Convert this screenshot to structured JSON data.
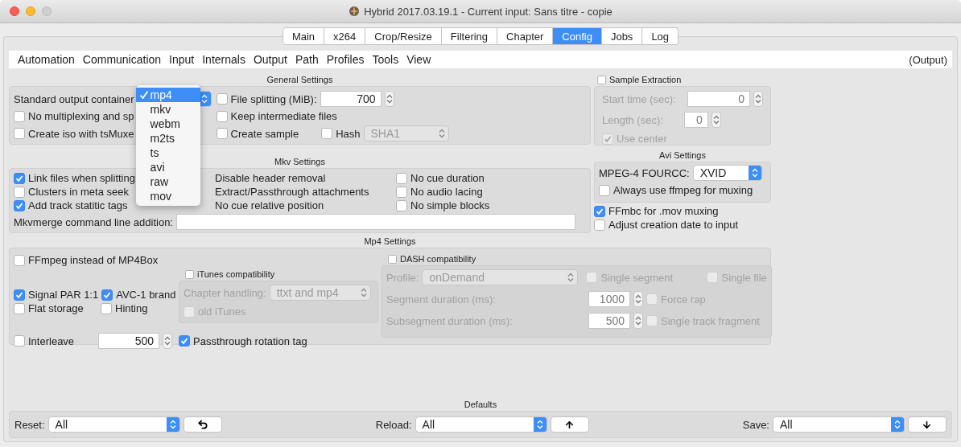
{
  "window": {
    "title": "Hybrid 2017.03.19.1 - Current input: Sans titre - copie"
  },
  "tabs": [
    {
      "label": "Main",
      "selected": false
    },
    {
      "label": "x264",
      "selected": false
    },
    {
      "label": "Crop/Resize",
      "selected": false
    },
    {
      "label": "Filtering",
      "selected": false
    },
    {
      "label": "Chapter",
      "selected": false
    },
    {
      "label": "Config",
      "selected": true
    },
    {
      "label": "Jobs",
      "selected": false
    },
    {
      "label": "Log",
      "selected": false
    }
  ],
  "menu": [
    "Automation",
    "Communication",
    "Input",
    "Internals",
    "Output",
    "Path",
    "Profiles",
    "Tools",
    "View"
  ],
  "menu_context": "(Output)",
  "general": {
    "title": "General Settings",
    "container_label": "Standard output container",
    "container_options": [
      {
        "label": "mp4",
        "selected": true
      },
      {
        "label": "mkv",
        "selected": false
      },
      {
        "label": "webm",
        "selected": false
      },
      {
        "label": "m2ts",
        "selected": false
      },
      {
        "label": "ts",
        "selected": false
      },
      {
        "label": "avi",
        "selected": false
      },
      {
        "label": "raw",
        "selected": false
      },
      {
        "label": "mov",
        "selected": false
      }
    ],
    "file_splitting": {
      "label": "File splitting (MiB):",
      "checked": false,
      "value": "700"
    },
    "no_multiplexing": {
      "label": "No multiplexing and sp",
      "checked": false
    },
    "keep_intermediate": {
      "label": "Keep intermediate files",
      "checked": false
    },
    "create_iso": {
      "label": "Create iso with tsMuxe",
      "checked": false
    },
    "create_sample": {
      "label": "Create sample",
      "checked": false
    },
    "hash": {
      "label": "Hash",
      "checked": false,
      "value": "SHA1",
      "disabled": true
    }
  },
  "sample_extraction": {
    "label": "Sample Extraction",
    "checked": false,
    "start_label": "Start time (sec):",
    "start_value": "0",
    "length_label": "Length (sec):",
    "length_value": "0",
    "use_center": {
      "label": "Use center",
      "checked": true
    }
  },
  "mkv": {
    "title": "Mkv Settings",
    "options_left": [
      {
        "label": "Link files when splitting",
        "checked": true
      },
      {
        "label": "Clusters in meta seek",
        "checked": false
      },
      {
        "label": "Add track statitic tags",
        "checked": true
      }
    ],
    "options_middle": [
      "Disable header removal",
      "Extract/Passthrough attachments",
      "No cue relative position"
    ],
    "options_right": [
      {
        "label": "No cue duration",
        "checked": false
      },
      {
        "label": "No audio lacing",
        "checked": false
      },
      {
        "label": "No simple blocks",
        "checked": false
      }
    ],
    "command_label": "Mkvmerge command line addition:"
  },
  "avi": {
    "title": "Avi Settings",
    "fourcc_label": "MPEG-4 FOURCC:",
    "fourcc_value": "XVID",
    "always_ffmpeg": {
      "label": "Always use ffmpeg for muxing",
      "checked": false
    }
  },
  "extra_options": [
    {
      "label": "FFmbc for .mov muxing",
      "checked": true
    },
    {
      "label": "Adjust creation date to input",
      "checked": false
    }
  ],
  "mp4": {
    "title": "Mp4 Settings",
    "ffmpeg": {
      "label": "FFmpeg instead of MP4Box",
      "checked": false
    },
    "signal_par": {
      "label": "Signal PAR 1:1",
      "checked": true
    },
    "avc1": {
      "label": "AVC-1 brand",
      "checked": true
    },
    "flat": {
      "label": "Flat storage",
      "checked": false
    },
    "hinting": {
      "label": "Hinting",
      "checked": false
    },
    "interleave": {
      "label": "Interleave",
      "checked": false,
      "value": "500"
    },
    "rotation": {
      "label": "Passthrough rotation tag",
      "checked": true
    },
    "itunes": {
      "label": "iTunes compatibility",
      "checked": false,
      "chapter_label": "Chapter handling:",
      "chapter_value": "ttxt and mp4",
      "old_itunes": {
        "label": "old iTunes",
        "checked": false
      }
    },
    "dash": {
      "label": "DASH compatibility",
      "checked": false,
      "profile_label": "Profile:",
      "profile_value": "onDemand",
      "single_segment": {
        "label": "Single segment",
        "checked": false
      },
      "single_file": {
        "label": "Single file",
        "checked": false
      },
      "segment_label": "Segment duration (ms):",
      "segment_value": "1000",
      "force_rap": {
        "label": "Force rap",
        "checked": false
      },
      "subsegment_label": "Subsegment duration (ms):",
      "subsegment_value": "500",
      "single_track": {
        "label": "Single track fragment",
        "checked": false
      }
    }
  },
  "defaults": {
    "title": "Defaults",
    "items": [
      {
        "label": "Reset:",
        "value": "All",
        "kind": "undo"
      },
      {
        "label": "Reload:",
        "value": "All",
        "kind": "up"
      },
      {
        "label": "Save:",
        "value": "All",
        "kind": "down"
      }
    ]
  }
}
